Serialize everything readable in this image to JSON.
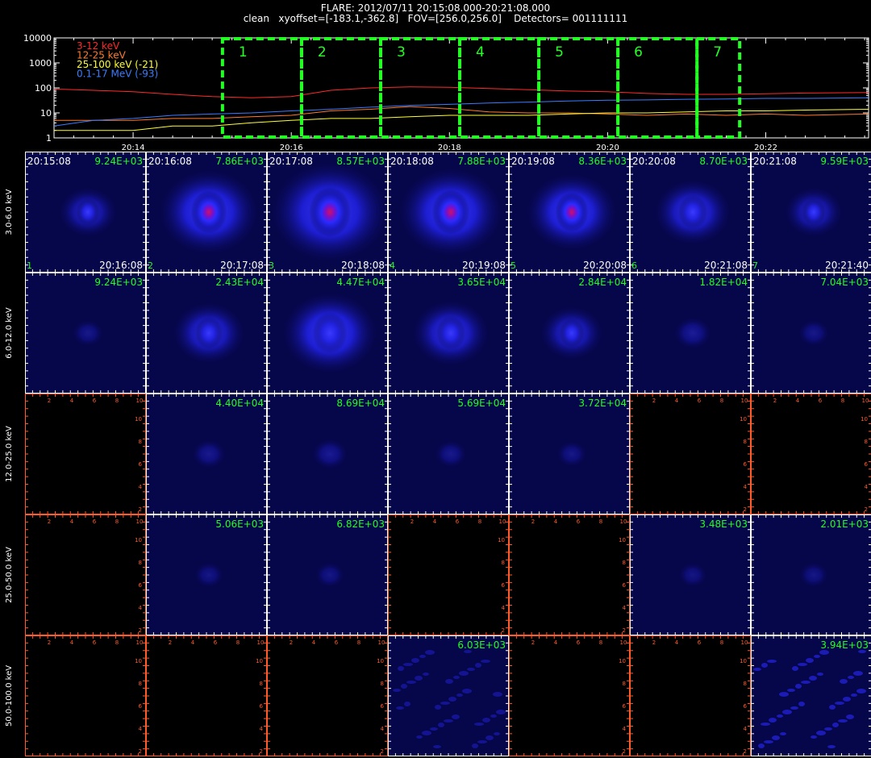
{
  "header": {
    "line1": "FLARE: 2012/07/11 20:15:08.000-20:21:08.000",
    "line2": "clean   xyoffset=[-183.1,-362.8]   FOV=[256.0,256.0]    Detectors= 001111111"
  },
  "chart_data": [
    {
      "type": "line",
      "title": "",
      "x_tick_labels": [
        "20:14",
        "20:16",
        "20:18",
        "20:20",
        "20:22"
      ],
      "x_tick_minutes": [
        14,
        16,
        18,
        20,
        22
      ],
      "xlim_minutes": [
        13.0,
        23.3
      ],
      "y_scale": "log",
      "y_tick_labels": [
        "1",
        "10",
        "100",
        "1000",
        "10000"
      ],
      "ylim": [
        1,
        10000
      ],
      "legend_position": "top-left",
      "series": [
        {
          "name": "3-12 keV",
          "color": "#ff2a2a",
          "x_minutes": [
            13.0,
            13.5,
            14.0,
            14.5,
            15.0,
            15.5,
            16.0,
            16.5,
            17.0,
            17.5,
            18.0,
            18.5,
            19.0,
            19.5,
            20.0,
            20.5,
            21.0,
            21.5,
            22.0,
            22.5,
            23.3
          ],
          "values": [
            90,
            80,
            70,
            55,
            45,
            40,
            45,
            80,
            100,
            110,
            105,
            95,
            85,
            75,
            70,
            60,
            55,
            55,
            58,
            62,
            65
          ]
        },
        {
          "name": "12-25 keV",
          "color": "#ff7a2a",
          "x_minutes": [
            13.0,
            13.5,
            14.0,
            14.5,
            15.0,
            15.5,
            16.0,
            16.5,
            17.0,
            17.5,
            18.0,
            18.5,
            19.0,
            19.5,
            20.0,
            20.5,
            21.0,
            21.5,
            22.0,
            22.5,
            23.3
          ],
          "values": [
            5,
            5,
            5,
            6,
            6,
            7,
            8,
            12,
            14,
            18,
            15,
            11,
            10,
            10,
            9,
            8,
            9,
            8,
            9,
            8,
            9
          ]
        },
        {
          "name": "25-100 keV (-21)",
          "color": "#ffff33",
          "x_minutes": [
            13.0,
            13.5,
            14.0,
            14.5,
            15.0,
            15.5,
            16.0,
            16.5,
            17.0,
            17.5,
            18.0,
            18.5,
            19.0,
            19.5,
            20.0,
            20.5,
            21.0,
            21.5,
            22.0,
            22.5,
            23.3
          ],
          "values": [
            2,
            2,
            2,
            3,
            3,
            4,
            5,
            6,
            6,
            7,
            8,
            8,
            8,
            9,
            10,
            10,
            11,
            12,
            12,
            13,
            14
          ]
        },
        {
          "name": "0.1-17 MeV (-93)",
          "color": "#3a7cff",
          "x_minutes": [
            13.0,
            13.5,
            14.0,
            14.5,
            15.0,
            15.5,
            16.0,
            16.5,
            17.0,
            17.5,
            18.0,
            18.5,
            19.0,
            19.5,
            20.0,
            20.5,
            21.0,
            21.5,
            22.0,
            22.5,
            23.3
          ],
          "values": [
            3,
            5,
            6,
            8,
            9,
            10,
            12,
            14,
            17,
            20,
            22,
            25,
            27,
            30,
            32,
            33,
            35,
            36,
            38,
            38,
            40
          ]
        }
      ],
      "time_intervals": {
        "labels": [
          "1",
          "2",
          "3",
          "4",
          "5",
          "6",
          "7"
        ],
        "start_minutes": [
          15.13,
          16.13,
          17.13,
          18.13,
          19.13,
          20.13,
          21.13
        ],
        "end_minutes": [
          16.13,
          17.13,
          18.13,
          19.13,
          20.13,
          21.13,
          21.67
        ],
        "color": "#22ff22"
      }
    },
    {
      "type": "heatmap",
      "title": "",
      "columns": [
        "1",
        "2",
        "3",
        "4",
        "5",
        "6",
        "7"
      ],
      "start_times": [
        "20:15:08",
        "20:16:08",
        "20:17:08",
        "20:18:08",
        "20:19:08",
        "20:20:08",
        "20:21:08"
      ],
      "end_times": [
        "20:16:08",
        "20:17:08",
        "20:18:08",
        "20:19:08",
        "20:20:08",
        "20:21:08",
        "20:21:40"
      ],
      "rows": [
        "3.0-6.0 keV",
        "6.0-12.0 keV",
        "12.0-25.0 keV",
        "25.0-50.0 keV",
        "50.0-100.0 keV"
      ],
      "peak_labels": [
        [
          "9.24E+03",
          "7.86E+03",
          "8.57E+03",
          "7.88E+03",
          "8.36E+03",
          "8.70E+03",
          "9.59E+03"
        ],
        [
          "9.24E+03",
          "2.43E+04",
          "4.47E+04",
          "3.65E+04",
          "2.84E+04",
          "1.82E+04",
          "7.04E+03"
        ],
        [
          "",
          "4.40E+04",
          "8.69E+04",
          "5.69E+04",
          "3.72E+04",
          "",
          ""
        ],
        [
          "",
          "5.06E+03",
          "6.82E+03",
          "",
          "",
          "3.48E+03",
          "2.01E+03"
        ],
        [
          "",
          "",
          "",
          "6.03E+03",
          "",
          "",
          "3.94E+03"
        ]
      ],
      "image_present": [
        [
          1,
          1,
          1,
          1,
          1,
          1,
          1
        ],
        [
          1,
          1,
          1,
          1,
          1,
          1,
          1
        ],
        [
          0,
          1,
          1,
          1,
          1,
          0,
          0
        ],
        [
          0,
          1,
          1,
          0,
          0,
          1,
          1
        ],
        [
          0,
          0,
          0,
          1,
          0,
          0,
          1
        ]
      ],
      "source_strength": [
        [
          0.35,
          0.8,
          1.0,
          0.85,
          0.7,
          0.55,
          0.35
        ],
        [
          0.05,
          0.5,
          0.75,
          0.55,
          0.4,
          0.12,
          0.05
        ],
        [
          0,
          0.08,
          0.1,
          0.06,
          0.04,
          0,
          0
        ],
        [
          0,
          0.03,
          0.03,
          0,
          0,
          0.02,
          0.03
        ],
        [
          0,
          0,
          0,
          0.15,
          0,
          0,
          0.35
        ]
      ],
      "blank_panel_axis_labels": [
        "2",
        "4",
        "6",
        "8",
        "10"
      ],
      "frame_color_image": "#ffffff",
      "frame_color_blank": "#ff5a2a",
      "label_color": "#22ff22"
    }
  ]
}
